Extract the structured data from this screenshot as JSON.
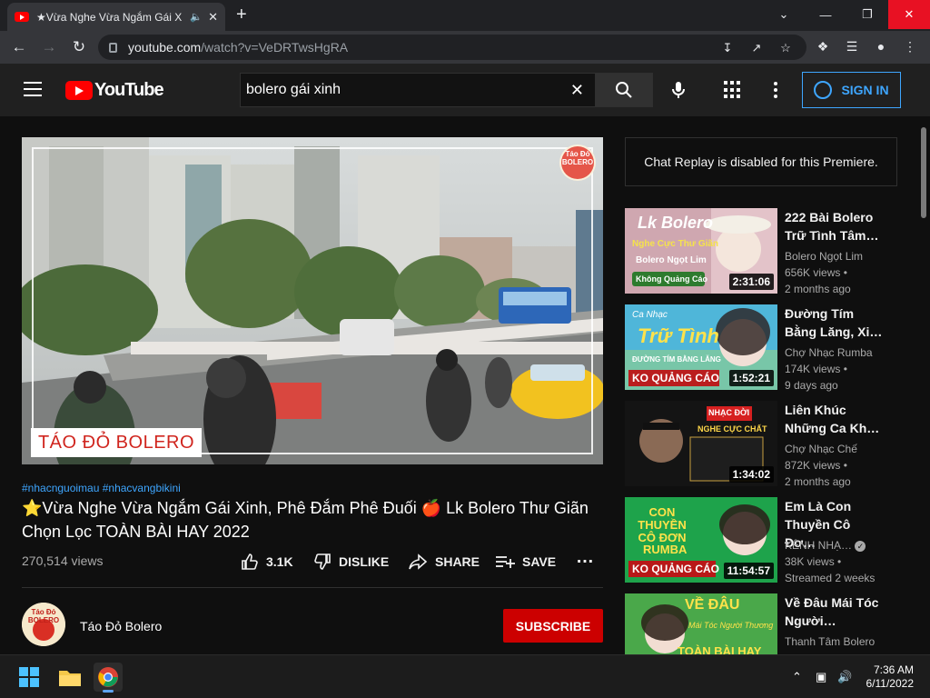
{
  "browser": {
    "tab_title": "★Vừa Nghe Vừa Ngắm Gái X",
    "new_tab": "+",
    "url_host": "youtube.com",
    "url_path": "/watch?v=VeDRTwsHgRA",
    "min": "—",
    "restore": "❐",
    "close": "✕",
    "tabs_dropdown": "⌄"
  },
  "yt_header": {
    "logo_text": "YouTube",
    "search_value": "bolero gái xinh",
    "sign_in": "SIGN IN"
  },
  "video": {
    "hashtags": "#nhacnguoimau #nhacvangbikini",
    "title": "⭐Vừa Nghe Vừa Ngắm Gái Xinh, Phê Đắm Phê Đuối 🍎 Lk Bolero Thư Giãn Chọn Lọc TOÀN BÀI HAY 2022",
    "views": "270,514 views",
    "likes": "3.1K",
    "dislike": "DISLIKE",
    "share": "SHARE",
    "save": "SAVE",
    "more": "…",
    "watermark": "TÁO ĐỎ BOLERO",
    "logo_badge": "Táo Đỏ BOLERO"
  },
  "channel": {
    "name": "Táo Đỏ Bolero",
    "avatar_text": "Táo Đỏ BOLERO",
    "subscribe": "SUBSCRIBE"
  },
  "sidebar": {
    "chat_notice": "Chat Replay is disabled for this Premiere.",
    "recs": [
      {
        "title": "222 Bài Bolero Trữ Tình Tâm…",
        "channel": "Bolero Ngọt Lim",
        "views": "656K views •",
        "age": "2 months ago",
        "duration": "2:31:06",
        "thumb_title": "Lk Bolero",
        "thumb_sub": "Nghe Cực Thư Giãn",
        "thumb_sub2": "Bolero Ngọt Lim",
        "thumb_tag": "Không Quảng Cáo"
      },
      {
        "title": "Đường Tím Bằng Lăng, Xi…",
        "channel": "Chợ Nhạc Rumba",
        "views": "174K views •",
        "age": "9 days ago",
        "duration": "1:52:21",
        "thumb_title": "Trữ Tình",
        "thumb_sub": "Ca Nhạc",
        "thumb_sub2": "ĐƯỜNG TÍM BẰNG LĂNG",
        "thumb_tag": "KO QUẢNG CÁO"
      },
      {
        "title": "Liên Khúc Những Ca Kh…",
        "channel": "Chợ Nhạc Chế",
        "views": "872K views •",
        "age": "2 months ago",
        "duration": "1:34:02",
        "thumb_title": "NHẠC ĐỜI",
        "thumb_sub": "NGHE CỰC CHẤT",
        "thumb_sub2": "",
        "thumb_tag": ""
      },
      {
        "title": "Em Là Con Thuyền Cô Đơ…",
        "channel": "KÊNH NHẠ…",
        "views": "38K views •",
        "age": "Streamed 2 weeks",
        "duration": "11:54:57",
        "thumb_title": "CON THUYỀN CÔ ĐƠN",
        "thumb_sub": "RUMBA",
        "thumb_sub2": "",
        "thumb_tag": "KO QUẢNG CÁO"
      },
      {
        "title": "Về Đâu Mái Tóc Người…",
        "channel": "Thanh Tâm Bolero",
        "views": "",
        "age": "",
        "duration": "",
        "thumb_title": "VỀ ĐÂU",
        "thumb_sub": "Mái Tóc Người Thương",
        "thumb_sub2": "",
        "thumb_tag": "TOÀN BÀI HAY"
      }
    ]
  },
  "taskbar": {
    "time": "7:36 AM",
    "date": "6/11/2022"
  },
  "colors": {
    "accent": "#3ea6ff",
    "subscribe": "#cc0000",
    "yt_red": "#ff0000",
    "bg": "#0f0f0f"
  }
}
